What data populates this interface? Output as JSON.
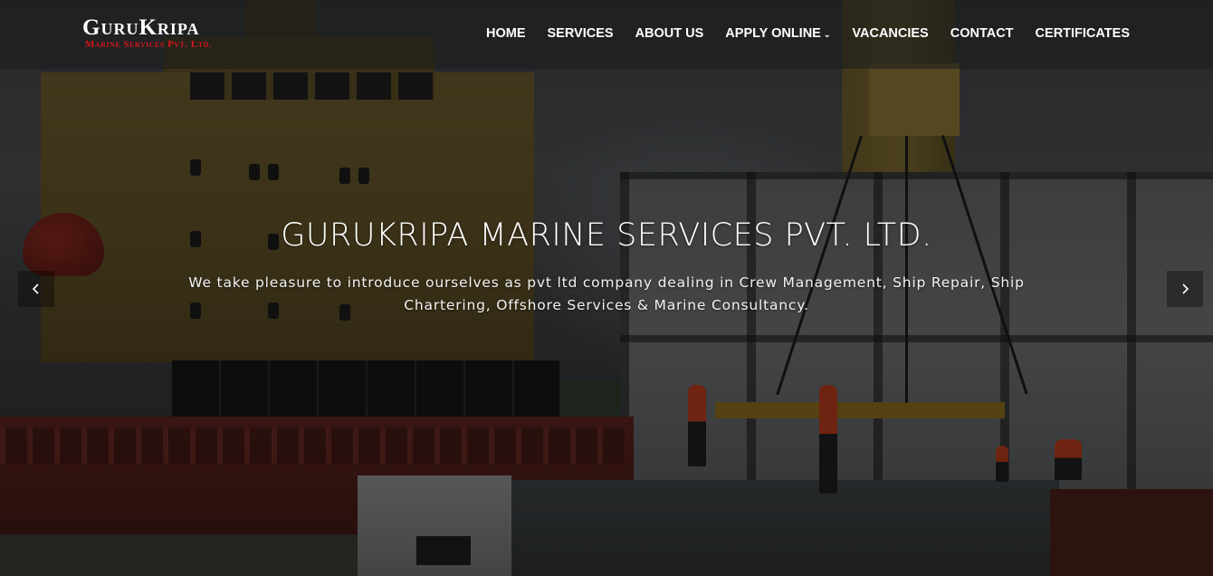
{
  "brand": {
    "name": "GuruKripa",
    "tagline": "Marine Services Pvt. Ltd."
  },
  "nav": {
    "items": [
      {
        "label": "HOME"
      },
      {
        "label": "SERVICES"
      },
      {
        "label": "ABOUT US"
      },
      {
        "label": "APPLY ONLINE",
        "has_dropdown": true
      },
      {
        "label": "VACANCIES"
      },
      {
        "label": "CONTACT"
      },
      {
        "label": "CERTIFICATES"
      }
    ]
  },
  "slider": {
    "title": "GURUKRIPA MARINE SERVICES PVT. LTD.",
    "text": "We take pleasure to introduce ourselves as pvt ltd company dealing in Crew Management, Ship Repair, Ship Chartering, Offshore Services & Marine Consultancy.",
    "prev_icon": "chevron-left-icon",
    "next_icon": "chevron-right-icon"
  },
  "colors": {
    "brand_red": "#d6151b",
    "text_white": "#ffffff",
    "header_bg": "rgba(25,27,30,0.55)"
  }
}
